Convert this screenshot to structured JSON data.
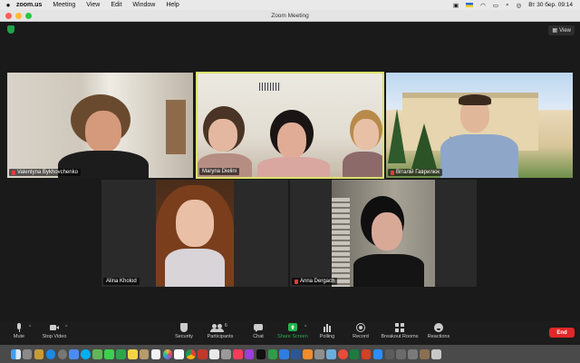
{
  "menubar": {
    "app": "zoom.us",
    "items": [
      "Meeting",
      "View",
      "Edit",
      "Window",
      "Help"
    ],
    "clock": "Вт 30 бер.  09:14"
  },
  "window": {
    "title": "Zoom Meeting"
  },
  "view_button": "View",
  "participants": [
    {
      "name": "Valentyna Bykhovchenko",
      "muted": true
    },
    {
      "name": "Maryna Dielini",
      "muted": false,
      "active_speaker": true
    },
    {
      "name": "Віталій Гаврилюк",
      "muted": true
    },
    {
      "name": "Alina Kholod",
      "muted": false
    },
    {
      "name": "Anna Dergach",
      "muted": true
    }
  ],
  "toolbar": {
    "mute": "Mute",
    "stop_video": "Stop Video",
    "security": "Security",
    "participants": "Participants",
    "participants_count": "6",
    "chat": "Chat",
    "share_screen": "Share Screen",
    "polling": "Polling",
    "record": "Record",
    "breakout_rooms": "Breakout Rooms",
    "reactions": "Reactions",
    "end": "End"
  },
  "colors": {
    "accent_green": "#26b24b",
    "end_red": "#e02828",
    "active_border": "#dde26a"
  }
}
